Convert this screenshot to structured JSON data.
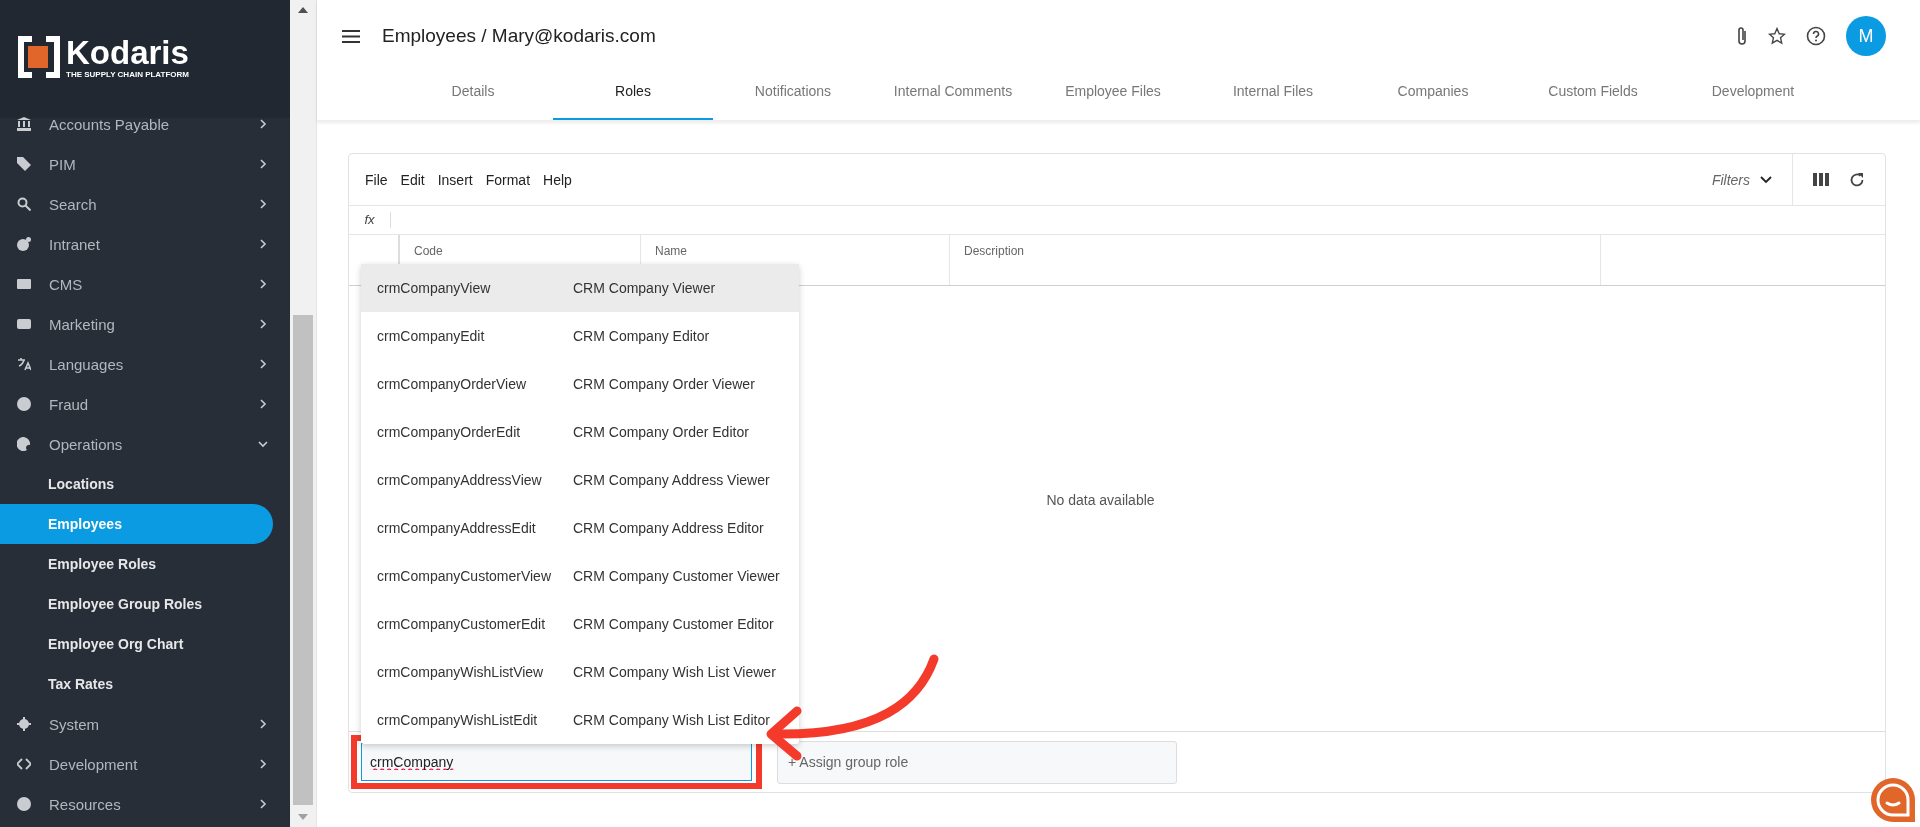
{
  "sidebar": {
    "logo": {
      "name": "Kodaris",
      "tagline": "THE SUPPLY CHAIN PLATFORM"
    },
    "items": [
      {
        "label": "Accounts Payable",
        "expanded": false
      },
      {
        "label": "PIM",
        "expanded": false
      },
      {
        "label": "Search",
        "expanded": false
      },
      {
        "label": "Intranet",
        "expanded": false
      },
      {
        "label": "CMS",
        "expanded": false
      },
      {
        "label": "Marketing",
        "expanded": false
      },
      {
        "label": "Languages",
        "expanded": false
      },
      {
        "label": "Fraud",
        "expanded": false
      },
      {
        "label": "Operations",
        "expanded": true,
        "children": [
          {
            "label": "Locations",
            "selected": false
          },
          {
            "label": "Employees",
            "selected": true
          },
          {
            "label": "Employee Roles",
            "selected": false
          },
          {
            "label": "Employee Group Roles",
            "selected": false
          },
          {
            "label": "Employee Org Chart",
            "selected": false
          },
          {
            "label": "Tax Rates",
            "selected": false
          }
        ]
      },
      {
        "label": "System",
        "expanded": false
      },
      {
        "label": "Development",
        "expanded": false
      },
      {
        "label": "Resources",
        "expanded": false
      }
    ]
  },
  "header": {
    "title": "Employees / Mary@kodaris.com",
    "avatar": "M",
    "tabs": [
      {
        "label": "Details",
        "selected": false
      },
      {
        "label": "Roles",
        "selected": true
      },
      {
        "label": "Notifications",
        "selected": false
      },
      {
        "label": "Internal Comments",
        "selected": false
      },
      {
        "label": "Employee Files",
        "selected": false
      },
      {
        "label": "Internal Files",
        "selected": false
      },
      {
        "label": "Companies",
        "selected": false
      },
      {
        "label": "Custom Fields",
        "selected": false
      },
      {
        "label": "Development",
        "selected": false
      }
    ]
  },
  "grid": {
    "menu": [
      "File",
      "Edit",
      "Insert",
      "Format",
      "Help"
    ],
    "filters": "Filters",
    "formula_label": "fx",
    "columns": [
      "Code",
      "Name",
      "Description"
    ],
    "empty_message": "No data available",
    "suggestions": [
      {
        "code": "crmCompanyView",
        "name": "CRM Company Viewer",
        "selected": true
      },
      {
        "code": "crmCompanyEdit",
        "name": "CRM Company Editor",
        "selected": false
      },
      {
        "code": "crmCompanyOrderView",
        "name": "CRM Company Order Viewer",
        "selected": false
      },
      {
        "code": "crmCompanyOrderEdit",
        "name": "CRM Company Order Editor",
        "selected": false
      },
      {
        "code": "crmCompanyAddressView",
        "name": "CRM Company Address Viewer",
        "selected": false
      },
      {
        "code": "crmCompanyAddressEdit",
        "name": "CRM Company Address Editor",
        "selected": false
      },
      {
        "code": "crmCompanyCustomerView",
        "name": "CRM Company Customer Viewer",
        "selected": false
      },
      {
        "code": "crmCompanyCustomerEdit",
        "name": "CRM Company Customer Editor",
        "selected": false
      },
      {
        "code": "crmCompanyWishListView",
        "name": "CRM Company Wish List Viewer",
        "selected": false
      },
      {
        "code": "crmCompanyWishListEdit",
        "name": "CRM Company Wish List Editor",
        "selected": false
      }
    ],
    "role_input": {
      "value": "crmCompany"
    },
    "group_role_input": {
      "placeholder": "+ Assign group role"
    }
  }
}
